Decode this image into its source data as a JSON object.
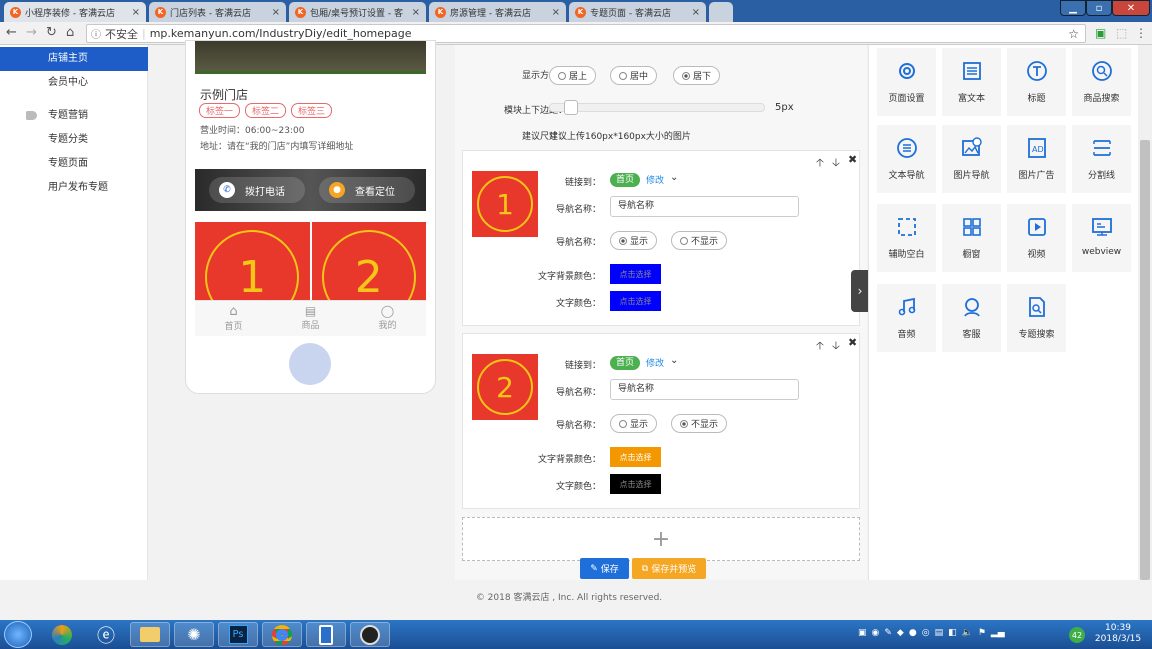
{
  "browser": {
    "tabs": [
      {
        "title": "小程序装修 - 客满云店"
      },
      {
        "title": "门店列表 - 客满云店"
      },
      {
        "title": "包厢/桌号预订设置 - 客"
      },
      {
        "title": "房源管理 - 客满云店"
      },
      {
        "title": "专题页面 - 客满云店"
      }
    ],
    "security": "不安全",
    "url": "mp.kemanyun.com/IndustryDiy/edit_homepage"
  },
  "sidebar": {
    "items": [
      {
        "label": "店铺主页",
        "active": true
      },
      {
        "label": "会员中心"
      },
      {
        "label": "专题营销"
      },
      {
        "label": "专题分类"
      },
      {
        "label": "专题页面"
      },
      {
        "label": "用户发布专题"
      }
    ]
  },
  "preview": {
    "store_name": "示例门店",
    "tags": [
      "标签一",
      "标签二",
      "标签三"
    ],
    "hours": "营业时间：06:00~23:00",
    "address": "地址：请在“我的门店”内填写详细地址",
    "call_btn": "拨打电话",
    "locate_btn": "查看定位",
    "nav_images": [
      "1",
      "2"
    ],
    "bottom_nav": [
      "首页",
      "商品",
      "我的"
    ]
  },
  "editor": {
    "display_label": "显示方式：",
    "display_options": [
      "居上",
      "居中",
      "居下"
    ],
    "display_selected": 2,
    "margin_label": "模块上下边距：",
    "margin_value": "5px",
    "margin_fraction": 0.05,
    "size_label": "建议尺寸：",
    "size_hint": "建议上传160px*160px大小的图片",
    "link_label": "链接到：",
    "name_label": "导航名称：",
    "show_label": "导航名称：",
    "bg_color_label": "文字背景颜色：",
    "text_color_label": "文字颜色：",
    "show_options": [
      "显示",
      "不显示"
    ],
    "swatch_text": "点击选择",
    "items": [
      {
        "number": "1",
        "link": "首页",
        "modify": "修改",
        "name_value": "导航名称",
        "show_selected": 0,
        "bg_color": "#0000ff",
        "text_color": "#0000ff"
      },
      {
        "number": "2",
        "link": "首页",
        "modify": "修改",
        "name_value": "导航名称",
        "show_selected": 1,
        "bg_color": "#f39800",
        "text_color": "#000000"
      }
    ],
    "add_symbol": "+",
    "save_btn": "保存",
    "save_preview_btn": "保存并预览"
  },
  "widgets": [
    {
      "label": "页面设置",
      "icon": "gear-icon"
    },
    {
      "label": "富文本",
      "icon": "rich-text-icon"
    },
    {
      "label": "标题",
      "icon": "title-icon"
    },
    {
      "label": "商品搜索",
      "icon": "search-icon"
    },
    {
      "label": "文本导航",
      "icon": "text-nav-icon"
    },
    {
      "label": "图片导航",
      "icon": "image-nav-icon"
    },
    {
      "label": "图片广告",
      "icon": "image-ad-icon"
    },
    {
      "label": "分割线",
      "icon": "divider-icon"
    },
    {
      "label": "辅助空白",
      "icon": "blank-icon"
    },
    {
      "label": "橱窗",
      "icon": "showcase-icon"
    },
    {
      "label": "视频",
      "icon": "video-icon"
    },
    {
      "label": "webview",
      "icon": "webview-icon"
    },
    {
      "label": "音频",
      "icon": "audio-icon"
    },
    {
      "label": "客服",
      "icon": "service-icon"
    },
    {
      "label": "专题搜索",
      "icon": "topic-search-icon"
    }
  ],
  "footer": "© 2018 客满云店 , Inc. All rights reserved.",
  "taskbar": {
    "time": "10:39",
    "date": "2018/3/15",
    "badge": "42"
  },
  "colors": {
    "accent": "#1e5dc7",
    "nav_red": "#e8382b",
    "nav_yellow": "#f5c518",
    "save_blue": "#1e6fd9",
    "save_orange": "#f5a623"
  }
}
